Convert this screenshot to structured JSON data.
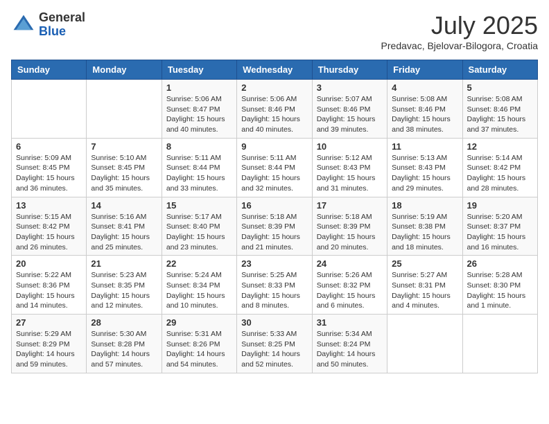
{
  "header": {
    "logo_line1": "General",
    "logo_line2": "Blue",
    "month": "July 2025",
    "location": "Predavac, Bjelovar-Bilogora, Croatia"
  },
  "weekdays": [
    "Sunday",
    "Monday",
    "Tuesday",
    "Wednesday",
    "Thursday",
    "Friday",
    "Saturday"
  ],
  "weeks": [
    [
      {
        "day": "",
        "text": ""
      },
      {
        "day": "",
        "text": ""
      },
      {
        "day": "1",
        "text": "Sunrise: 5:06 AM\nSunset: 8:47 PM\nDaylight: 15 hours and 40 minutes."
      },
      {
        "day": "2",
        "text": "Sunrise: 5:06 AM\nSunset: 8:46 PM\nDaylight: 15 hours and 40 minutes."
      },
      {
        "day": "3",
        "text": "Sunrise: 5:07 AM\nSunset: 8:46 PM\nDaylight: 15 hours and 39 minutes."
      },
      {
        "day": "4",
        "text": "Sunrise: 5:08 AM\nSunset: 8:46 PM\nDaylight: 15 hours and 38 minutes."
      },
      {
        "day": "5",
        "text": "Sunrise: 5:08 AM\nSunset: 8:46 PM\nDaylight: 15 hours and 37 minutes."
      }
    ],
    [
      {
        "day": "6",
        "text": "Sunrise: 5:09 AM\nSunset: 8:45 PM\nDaylight: 15 hours and 36 minutes."
      },
      {
        "day": "7",
        "text": "Sunrise: 5:10 AM\nSunset: 8:45 PM\nDaylight: 15 hours and 35 minutes."
      },
      {
        "day": "8",
        "text": "Sunrise: 5:11 AM\nSunset: 8:44 PM\nDaylight: 15 hours and 33 minutes."
      },
      {
        "day": "9",
        "text": "Sunrise: 5:11 AM\nSunset: 8:44 PM\nDaylight: 15 hours and 32 minutes."
      },
      {
        "day": "10",
        "text": "Sunrise: 5:12 AM\nSunset: 8:43 PM\nDaylight: 15 hours and 31 minutes."
      },
      {
        "day": "11",
        "text": "Sunrise: 5:13 AM\nSunset: 8:43 PM\nDaylight: 15 hours and 29 minutes."
      },
      {
        "day": "12",
        "text": "Sunrise: 5:14 AM\nSunset: 8:42 PM\nDaylight: 15 hours and 28 minutes."
      }
    ],
    [
      {
        "day": "13",
        "text": "Sunrise: 5:15 AM\nSunset: 8:42 PM\nDaylight: 15 hours and 26 minutes."
      },
      {
        "day": "14",
        "text": "Sunrise: 5:16 AM\nSunset: 8:41 PM\nDaylight: 15 hours and 25 minutes."
      },
      {
        "day": "15",
        "text": "Sunrise: 5:17 AM\nSunset: 8:40 PM\nDaylight: 15 hours and 23 minutes."
      },
      {
        "day": "16",
        "text": "Sunrise: 5:18 AM\nSunset: 8:39 PM\nDaylight: 15 hours and 21 minutes."
      },
      {
        "day": "17",
        "text": "Sunrise: 5:18 AM\nSunset: 8:39 PM\nDaylight: 15 hours and 20 minutes."
      },
      {
        "day": "18",
        "text": "Sunrise: 5:19 AM\nSunset: 8:38 PM\nDaylight: 15 hours and 18 minutes."
      },
      {
        "day": "19",
        "text": "Sunrise: 5:20 AM\nSunset: 8:37 PM\nDaylight: 15 hours and 16 minutes."
      }
    ],
    [
      {
        "day": "20",
        "text": "Sunrise: 5:22 AM\nSunset: 8:36 PM\nDaylight: 15 hours and 14 minutes."
      },
      {
        "day": "21",
        "text": "Sunrise: 5:23 AM\nSunset: 8:35 PM\nDaylight: 15 hours and 12 minutes."
      },
      {
        "day": "22",
        "text": "Sunrise: 5:24 AM\nSunset: 8:34 PM\nDaylight: 15 hours and 10 minutes."
      },
      {
        "day": "23",
        "text": "Sunrise: 5:25 AM\nSunset: 8:33 PM\nDaylight: 15 hours and 8 minutes."
      },
      {
        "day": "24",
        "text": "Sunrise: 5:26 AM\nSunset: 8:32 PM\nDaylight: 15 hours and 6 minutes."
      },
      {
        "day": "25",
        "text": "Sunrise: 5:27 AM\nSunset: 8:31 PM\nDaylight: 15 hours and 4 minutes."
      },
      {
        "day": "26",
        "text": "Sunrise: 5:28 AM\nSunset: 8:30 PM\nDaylight: 15 hours and 1 minute."
      }
    ],
    [
      {
        "day": "27",
        "text": "Sunrise: 5:29 AM\nSunset: 8:29 PM\nDaylight: 14 hours and 59 minutes."
      },
      {
        "day": "28",
        "text": "Sunrise: 5:30 AM\nSunset: 8:28 PM\nDaylight: 14 hours and 57 minutes."
      },
      {
        "day": "29",
        "text": "Sunrise: 5:31 AM\nSunset: 8:26 PM\nDaylight: 14 hours and 54 minutes."
      },
      {
        "day": "30",
        "text": "Sunrise: 5:33 AM\nSunset: 8:25 PM\nDaylight: 14 hours and 52 minutes."
      },
      {
        "day": "31",
        "text": "Sunrise: 5:34 AM\nSunset: 8:24 PM\nDaylight: 14 hours and 50 minutes."
      },
      {
        "day": "",
        "text": ""
      },
      {
        "day": "",
        "text": ""
      }
    ]
  ]
}
